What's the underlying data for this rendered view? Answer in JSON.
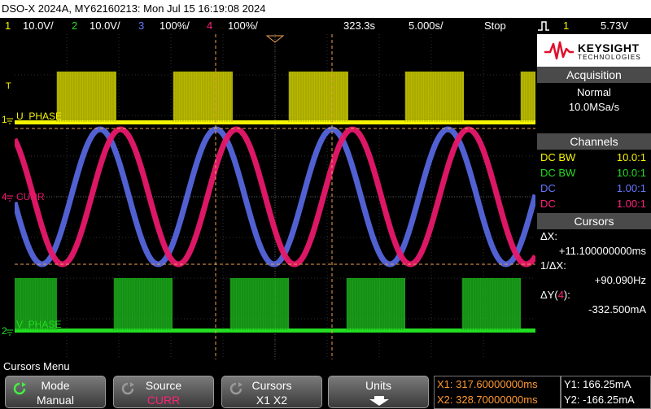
{
  "title": {
    "text": "DSO-X 2024A, MY62160213: Mon Jul 15 16:19:08 2024"
  },
  "status": {
    "ch1": {
      "num": "1",
      "scale": "10.0V/",
      "color": "#f5f500"
    },
    "ch2": {
      "num": "2",
      "scale": "10.0V/",
      "color": "#22dd22"
    },
    "ch3": {
      "num": "3",
      "scale": "100%/",
      "color": "#6677ff"
    },
    "ch4": {
      "num": "4",
      "scale": "100%/",
      "color": "#ff2277"
    },
    "delay": "323.3s",
    "timebase": "5.000s/",
    "run_state": "Stop",
    "trig_source": "1",
    "trig_level": "5.73V"
  },
  "waveforms": {
    "ch1_label": "U_PHASE",
    "ch2_label": "V_PHASE",
    "ch4_label": "CURR",
    "ch1_color": "#f5f500",
    "ch2_color": "#22dd22",
    "ch3_color": "#5566dd",
    "ch4_color": "#e8186a",
    "cursor_color": "#f0a050"
  },
  "brand": {
    "name": "KEYSIGHT",
    "sub": "TECHNOLOGIES"
  },
  "acquisition": {
    "heading": "Acquisition",
    "mode": "Normal",
    "rate": "10.0MSa/s"
  },
  "channels": {
    "heading": "Channels",
    "rows": [
      {
        "coupling": "DC BW",
        "probe": "10.0:1",
        "color": "#f5f500"
      },
      {
        "coupling": "DC BW",
        "probe": "10.0:1",
        "color": "#22dd22"
      },
      {
        "coupling": "DC",
        "probe": "1.00:1",
        "color": "#6677ff"
      },
      {
        "coupling": "DC",
        "probe": "1.00:1",
        "color": "#ff2277"
      }
    ]
  },
  "cursors": {
    "heading": "Cursors",
    "dx_label": "ΔX:",
    "dx_value": "+11.100000000ms",
    "inv_dx_label": "1/ΔX:",
    "inv_dx_value": "+90.090Hz",
    "dy_label_pre": "ΔY(",
    "dy_label_ch": "4",
    "dy_label_post": "):",
    "dy_value": "-332.500mA"
  },
  "menu": {
    "title": "Cursors Menu",
    "mode_top": "Mode",
    "mode_bottom": "Manual",
    "source_top": "Source",
    "source_bottom": "CURR",
    "cursors_top": "Cursors",
    "cursors_bottom": "X1 X2",
    "units_top": "Units"
  },
  "readout": {
    "x1": "X1: 317.60000000ms",
    "x2": "X2: 328.70000000ms",
    "y1": "Y1: 166.25mA",
    "y2": "Y2: -166.25mA"
  }
}
